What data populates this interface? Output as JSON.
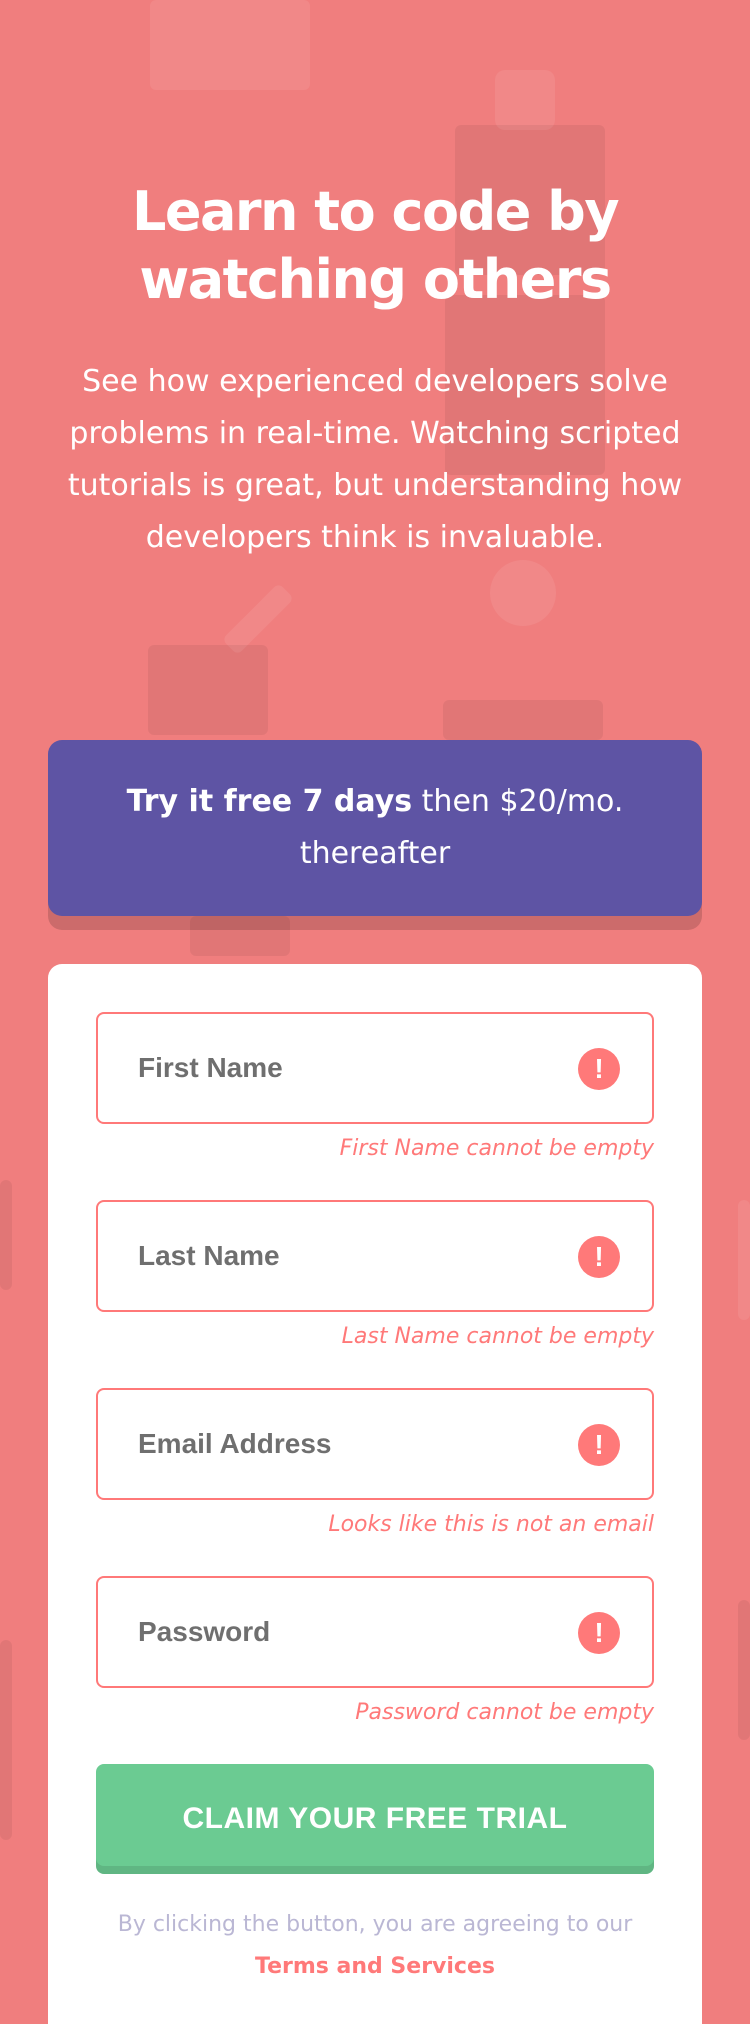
{
  "hero": {
    "title": "Learn to code by watching others",
    "description": "See how experienced developers solve problems in real-time. Watching scripted tutorials is great, but understanding how developers think is invaluable."
  },
  "promo": {
    "bold": "Try it free 7 days",
    "rest": " then $20/mo. thereafter"
  },
  "form": {
    "fields": [
      {
        "placeholder": "First Name",
        "error": "First Name cannot be empty",
        "icon": "error-icon"
      },
      {
        "placeholder": "Last Name",
        "error": "Last Name cannot be empty",
        "icon": "error-icon"
      },
      {
        "placeholder": "Email Address",
        "error": "Looks like this is not an email",
        "icon": "error-icon"
      },
      {
        "placeholder": "Password",
        "error": "Password cannot be empty",
        "icon": "error-icon"
      }
    ],
    "error_icon_glyph": "!",
    "submit_label": "CLAIM YOUR FREE TRIAL",
    "terms_prefix": "By clicking the button, you are agreeing to our ",
    "terms_link": "Terms and Services"
  },
  "colors": {
    "background": "#F07E7E",
    "promo": "#5E54A4",
    "accent_red": "#FF7979",
    "button_green": "#6BCB92",
    "muted_text": "#BAB7D4"
  }
}
